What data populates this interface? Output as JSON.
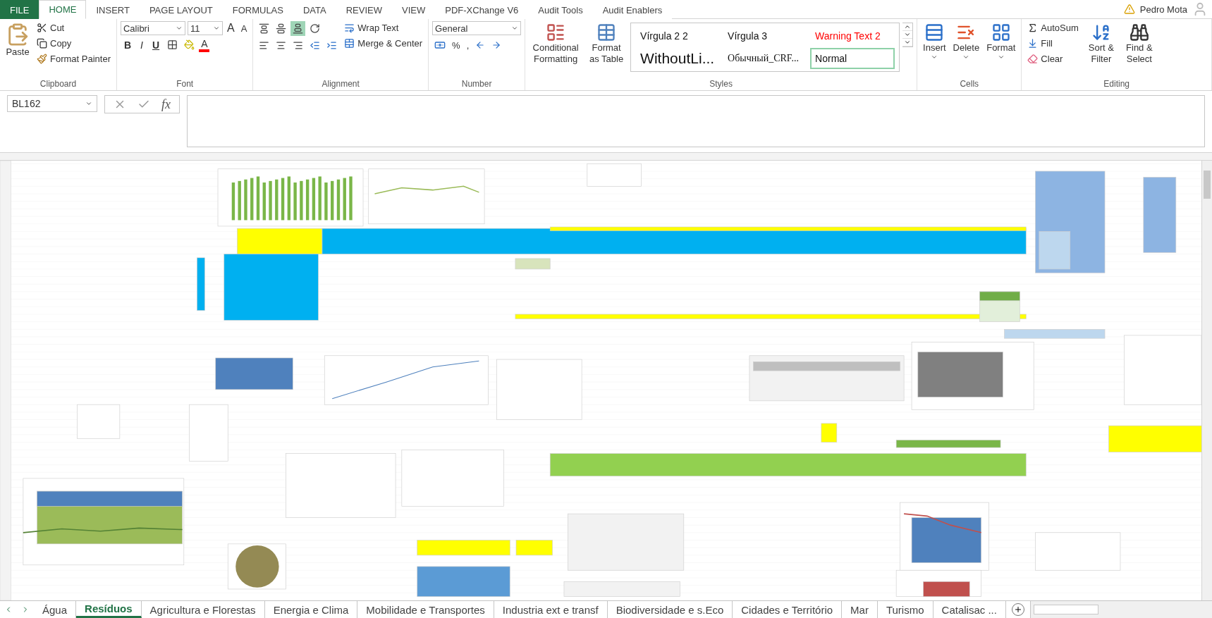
{
  "menu_tabs": [
    {
      "label": "FILE",
      "selected": false,
      "kind": "file"
    },
    {
      "label": "HOME",
      "selected": true,
      "kind": "tab"
    },
    {
      "label": "INSERT",
      "selected": false,
      "kind": "tab"
    },
    {
      "label": "PAGE LAYOUT",
      "selected": false,
      "kind": "tab"
    },
    {
      "label": "FORMULAS",
      "selected": false,
      "kind": "tab"
    },
    {
      "label": "DATA",
      "selected": false,
      "kind": "tab"
    },
    {
      "label": "REVIEW",
      "selected": false,
      "kind": "tab"
    },
    {
      "label": "VIEW",
      "selected": false,
      "kind": "tab"
    },
    {
      "label": "PDF-XChange V6",
      "selected": false,
      "kind": "tab"
    },
    {
      "label": "Audit Tools",
      "selected": false,
      "kind": "tab"
    },
    {
      "label": "Audit Enablers",
      "selected": false,
      "kind": "tab"
    }
  ],
  "user": {
    "name": "Pedro Mota"
  },
  "clipboard": {
    "paste": "Paste",
    "cut": "Cut",
    "copy": "Copy",
    "format_painter": "Format Painter",
    "label": "Clipboard"
  },
  "font": {
    "name": "Calibri",
    "size": "11",
    "bold": "B",
    "italic": "I",
    "underline": "U",
    "grow": "A",
    "shrink": "A",
    "font_color": "A",
    "label": "Font"
  },
  "alignment": {
    "wrap": "Wrap Text",
    "merge": "Merge & Center",
    "label": "Alignment"
  },
  "number": {
    "format": "General",
    "percent": "%",
    "comma": ",",
    "label": "Number"
  },
  "styles": {
    "conditional": "Conditional Formatting",
    "format_table": "Format as Table",
    "label": "Styles",
    "gallery": [
      {
        "label": "Vírgula 2 2",
        "kind": "plain",
        "selected": false
      },
      {
        "label": "Vírgula 3",
        "kind": "plain",
        "selected": false
      },
      {
        "label": "Warning Text 2",
        "kind": "warning",
        "selected": false
      },
      {
        "label": "WithoutLi...",
        "kind": "large",
        "selected": false
      },
      {
        "label": "Обычный_CRF...",
        "kind": "serif",
        "selected": false
      },
      {
        "label": "Normal",
        "kind": "plain",
        "selected": true
      }
    ]
  },
  "cells": {
    "items": [
      "Insert",
      "Delete",
      "Format"
    ],
    "label": "Cells"
  },
  "editing": {
    "autosum": "AutoSum",
    "fill": "Fill",
    "clear": "Clear",
    "sort": "Sort & Filter",
    "find": "Find & Select",
    "label": "Editing"
  },
  "formula_bar": {
    "name_box": "BL162",
    "fx": "fx"
  },
  "sheet_tabs": [
    {
      "label": "Água",
      "selected": false
    },
    {
      "label": "Resíduos",
      "selected": true
    },
    {
      "label": "Agricultura e Florestas",
      "selected": false
    },
    {
      "label": "Energia e Clima",
      "selected": false
    },
    {
      "label": "Mobilidade e Transportes",
      "selected": false
    },
    {
      "label": "Industria ext e transf",
      "selected": false
    },
    {
      "label": "Biodiversidade e s.Eco",
      "selected": false
    },
    {
      "label": "Cidades e Território",
      "selected": false
    },
    {
      "label": "Mar",
      "selected": false
    },
    {
      "label": "Turismo",
      "selected": false
    },
    {
      "label": "Catalisac ...",
      "selected": false
    }
  ]
}
